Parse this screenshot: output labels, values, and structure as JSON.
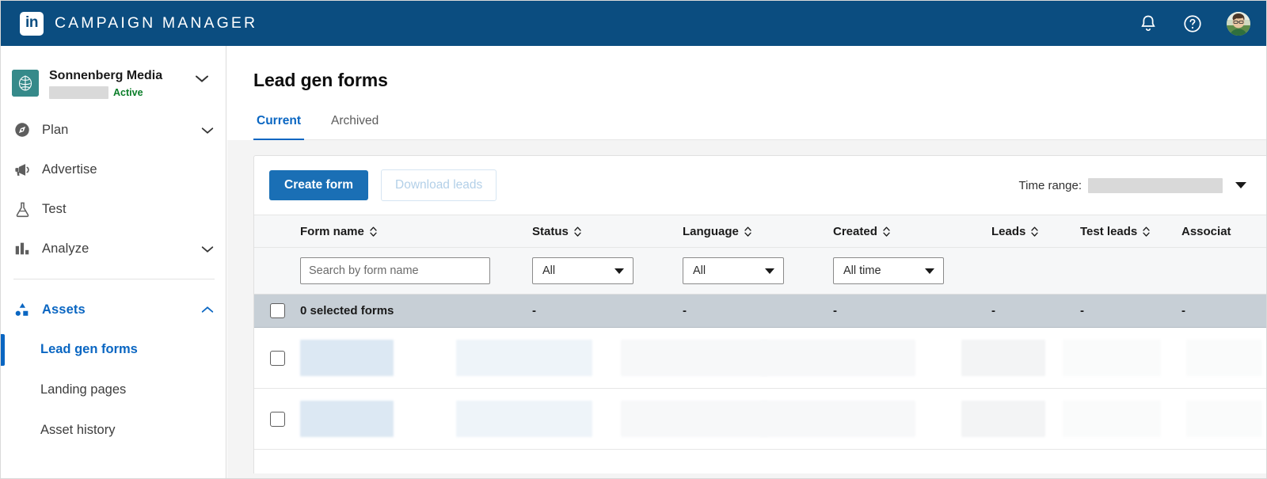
{
  "topbar": {
    "brand_name": "CAMPAIGN MANAGER",
    "logo_text": "in",
    "icons": [
      {
        "name": "notifications-bell-icon",
        "label": "Notifications"
      },
      {
        "name": "help-question-icon",
        "label": "Help"
      },
      {
        "name": "user-avatar",
        "label": "Account"
      }
    ],
    "background_color": "#0b4d80"
  },
  "sidebar": {
    "account": {
      "name": "Sonnenberg Media",
      "status": "Active",
      "status_color": "#0a7d28",
      "logo_color": "#368a8a",
      "redacted": true
    },
    "items": [
      {
        "label": "Plan",
        "icon": "compass-icon",
        "expandable": true,
        "active": false
      },
      {
        "label": "Advertise",
        "icon": "megaphone-icon",
        "expandable": false,
        "active": false
      },
      {
        "label": "Test",
        "icon": "flask-icon",
        "expandable": false,
        "active": false
      },
      {
        "label": "Analyze",
        "icon": "bar-chart-icon",
        "expandable": true,
        "active": false
      },
      {
        "label": "Assets",
        "icon": "shapes-icon",
        "expandable": true,
        "active": true
      }
    ],
    "subitems": [
      {
        "label": "Lead gen forms",
        "active": true
      },
      {
        "label": "Landing pages",
        "active": false
      },
      {
        "label": "Asset history",
        "active": false
      }
    ]
  },
  "main": {
    "title": "Lead gen forms",
    "tabs": [
      {
        "label": "Current",
        "active": true
      },
      {
        "label": "Archived",
        "active": false
      }
    ],
    "toolbar": {
      "create_label": "Create form",
      "download_label": "Download leads",
      "download_disabled": true,
      "time_range_label": "Time range:",
      "time_range_value": "",
      "time_range_redacted": true
    },
    "table": {
      "columns": [
        {
          "key": "form_name",
          "label": "Form name",
          "sortable": true
        },
        {
          "key": "status",
          "label": "Status",
          "sortable": true
        },
        {
          "key": "language",
          "label": "Language",
          "sortable": true
        },
        {
          "key": "created",
          "label": "Created",
          "sortable": true
        },
        {
          "key": "leads",
          "label": "Leads",
          "sortable": true
        },
        {
          "key": "test_leads",
          "label": "Test leads",
          "sortable": true
        },
        {
          "key": "associated",
          "label": "Associat",
          "sortable": false
        }
      ],
      "filters": {
        "search_placeholder": "Search by form name",
        "search_value": "",
        "status_value": "All",
        "language_value": "All",
        "created_value": "All time"
      },
      "selection": {
        "label": "0 selected forms",
        "count": 0,
        "checked": false,
        "summary_values": [
          "-",
          "-",
          "-",
          "-",
          "-",
          "-"
        ]
      },
      "rows": [
        {
          "checked": false,
          "redacted": true
        },
        {
          "checked": false,
          "redacted": true
        }
      ]
    }
  },
  "colors": {
    "brand_blue": "#0a66c2",
    "header_blue": "#0b4d80",
    "primary_button": "#1a6fb5",
    "page_bg": "#f4f4f4"
  }
}
